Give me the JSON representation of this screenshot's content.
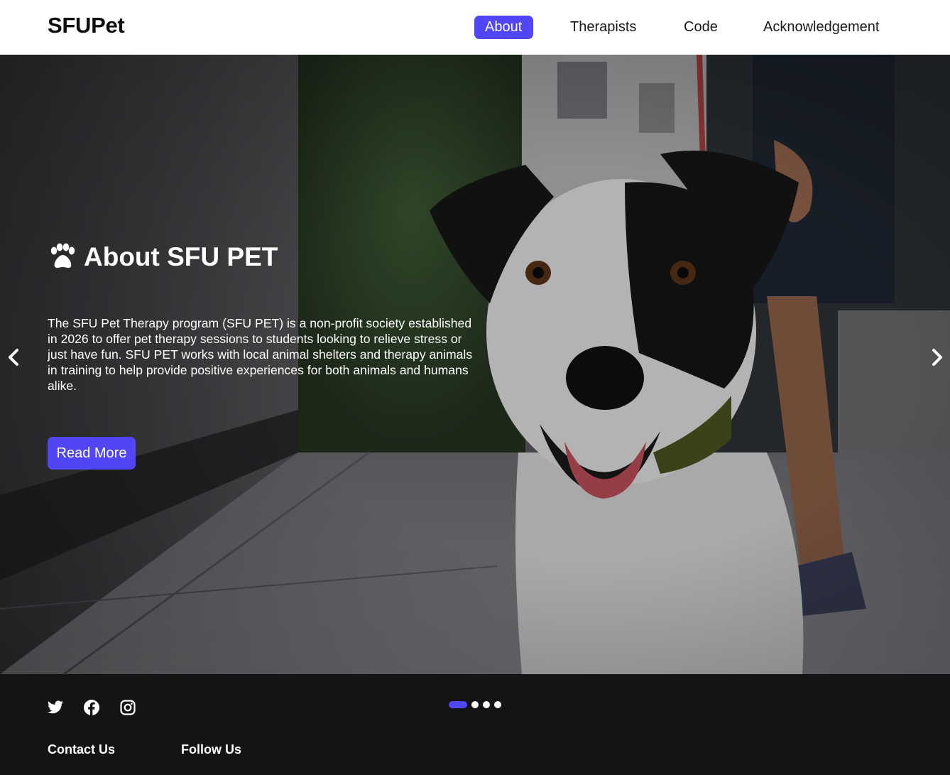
{
  "header": {
    "brand": "SFUPet",
    "nav": [
      {
        "label": "About",
        "active": true
      },
      {
        "label": "Therapists",
        "active": false
      },
      {
        "label": "Code",
        "active": false
      },
      {
        "label": "Acknowledgement",
        "active": false
      }
    ]
  },
  "hero": {
    "title": "About SFU PET",
    "title_icon": "paw-icon",
    "description": "The SFU Pet Therapy program (SFU PET) is a non-profit society established in 2026 to offer pet therapy sessions to students looking to relieve stress or just have fun. SFU PET works with local animal shelters and therapy animals in training to help provide positive experiences for both animals and humans alike.",
    "button_label": "Read More",
    "prev_icon": "chevron-left-icon",
    "next_icon": "chevron-right-icon"
  },
  "carousel": {
    "slide_count": 4,
    "active_index": 0
  },
  "footer": {
    "social_icons": [
      "twitter-icon",
      "facebook-icon",
      "instagram-icon"
    ],
    "headings": {
      "contact": "Contact Us",
      "follow": "Follow Us"
    }
  },
  "colors": {
    "accent": "#5046f5",
    "footer_bg": "#141414",
    "header_bg": "#ffffff"
  }
}
